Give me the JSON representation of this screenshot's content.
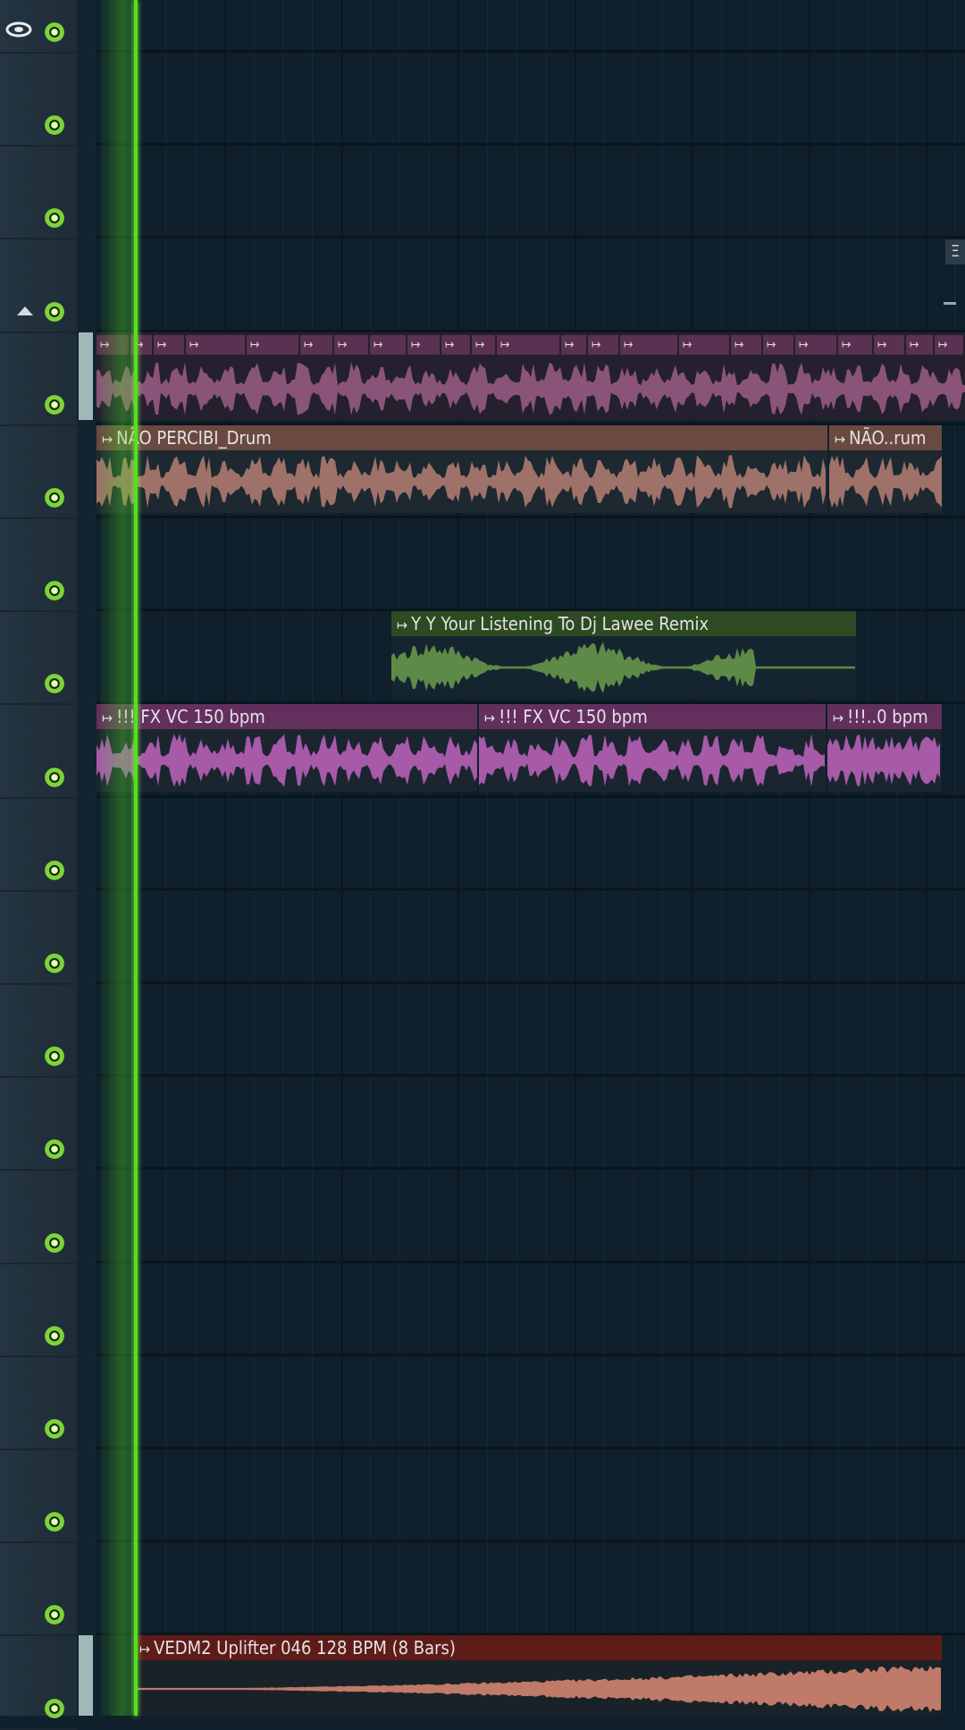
{
  "icons": {
    "eye": "eye-icon",
    "collapse": "triangle-up-icon",
    "clip_arrow": "clip-arrow-icon",
    "mute_led": "track-mute-led",
    "right_button": "menu-icon"
  },
  "colors": {
    "background": "#0f1f2b",
    "playhead": "#55e020",
    "drum_loop_clips": "#8a5478",
    "drum_clip": "#9e7268",
    "remix_clip": "#5e8a48",
    "fx_clip": "#a65aa8",
    "uplifter_clip": "#c07a68"
  },
  "tracks": 19,
  "clips": {
    "drum_loop": {
      "label": ""
    },
    "nao_drum_1": {
      "label": "NÃO PERCIBI_Drum"
    },
    "nao_drum_2": {
      "label": "NÃO..rum"
    },
    "remix": {
      "label": "Y Y Your Listening To Dj Lawee Remix"
    },
    "fx_1": {
      "label": "!!! FX VC 150 bpm"
    },
    "fx_2": {
      "label": "!!! FX VC 150 bpm"
    },
    "fx_3": {
      "label": "!!!..0 bpm"
    },
    "uplifter": {
      "label": "VEDM2 Uplifter 046 128 BPM (8 Bars)"
    }
  },
  "right_button_label": "Ξ"
}
